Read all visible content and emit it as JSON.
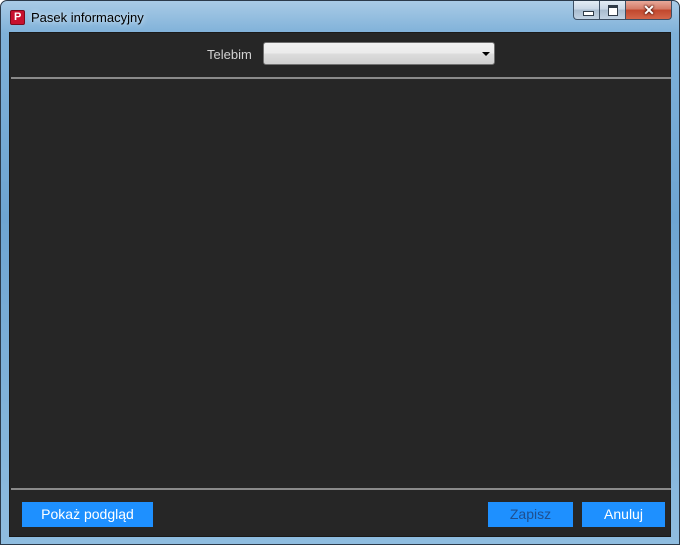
{
  "window": {
    "title": "Pasek informacyjny",
    "app_icon_letter": "P",
    "close_glyph": "✕"
  },
  "form": {
    "telebim_label": "Telebim",
    "telebim_value": ""
  },
  "buttons": {
    "preview_label": "Pokaż podgląd",
    "save_label": "Zapisz",
    "cancel_label": "Anuluj"
  },
  "colors": {
    "panel_background": "#262626",
    "button_accent": "#1e90ff",
    "separator": "#8a8a8a"
  }
}
